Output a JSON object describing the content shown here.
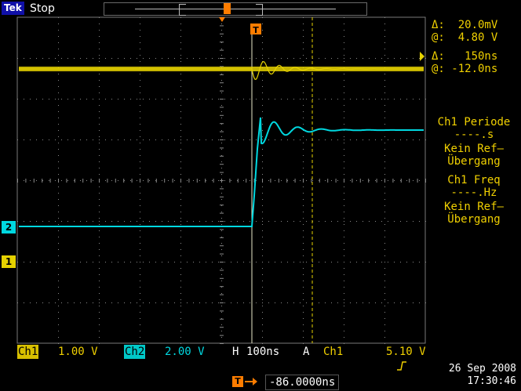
{
  "top": {
    "brand": "Tek",
    "status": "Stop"
  },
  "cursor_readout": {
    "amp_delta": "Δ:  20.0mV",
    "amp_at": "@:  4.80 V",
    "time_delta": "Δ:   150ns",
    "time_at": "@: -12.0ns"
  },
  "measurements": {
    "m1_title": "Ch1 Periode",
    "m1_value": "----.s",
    "m1_note1": "Kein Ref–",
    "m1_note2": "Übergang",
    "m2_title": "Ch1 Freq",
    "m2_value": "----.Hz",
    "m2_note1": "Kein Ref–",
    "m2_note2": "Übergang"
  },
  "bottom": {
    "ch1_label": "Ch1",
    "ch1_scale": "1.00 V",
    "ch2_label": "Ch2",
    "ch2_scale": "2.00 V",
    "h_label": "H",
    "h_scale": "100ns",
    "a_label": "A",
    "trig_source": "Ch1",
    "trig_slope_icon": "rising-edge-icon",
    "trig_level": "5.10 V"
  },
  "horizontal_delay": "-86.0000ns",
  "date": "26 Sep  2008",
  "time": "17:30:46",
  "markers": {
    "ch2": "2",
    "ch1": "1",
    "trigger": "T"
  },
  "colors": {
    "ch1": "#e6d200",
    "ch2": "#00d8e0",
    "trigger": "#ff7d00"
  }
}
